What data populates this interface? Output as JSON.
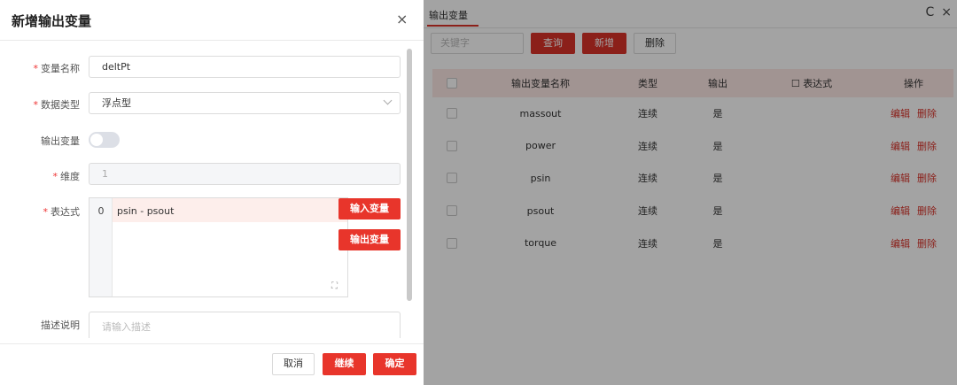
{
  "dialog": {
    "title": "新增输出变量",
    "close_icon": "×",
    "form": {
      "name_label": "变量名称",
      "name_value": "deltPt",
      "type_label": "数据类型",
      "type_value": "浮点型",
      "output_label": "输出变量",
      "output_on": false,
      "dim_label": "维度",
      "dim_value": "1",
      "expr_label": "表达式",
      "expr_line_no": "0",
      "expr_code": "psin - psout",
      "input_var_button": "输入变量",
      "output_var_button": "输出变量",
      "desc_label": "描述说明",
      "desc_placeholder": "请输入描述"
    },
    "footer": {
      "cancel": "取消",
      "continue": "继续",
      "confirm": "确定"
    }
  },
  "panel": {
    "tab": "输出变量",
    "icons": {
      "refresh": "C",
      "close": "×"
    },
    "toolbar": {
      "keyword_placeholder": "关键字",
      "search": "查询",
      "add": "新增",
      "delete": "删除"
    },
    "table": {
      "headers": [
        "输出变量名称",
        "类型",
        "输出",
        "表达式",
        "操作"
      ],
      "rows": [
        {
          "name": "massout",
          "type": "连续",
          "output": "是"
        },
        {
          "name": "power",
          "type": "连续",
          "output": "是"
        },
        {
          "name": "psin",
          "type": "连续",
          "output": "是"
        },
        {
          "name": "psout",
          "type": "连续",
          "output": "是"
        },
        {
          "name": "torque",
          "type": "连续",
          "output": "是"
        }
      ],
      "edit": "编辑",
      "remove": "删除"
    }
  },
  "colors": {
    "accent": "#e8352b",
    "header_bg": "#fce8e5"
  }
}
